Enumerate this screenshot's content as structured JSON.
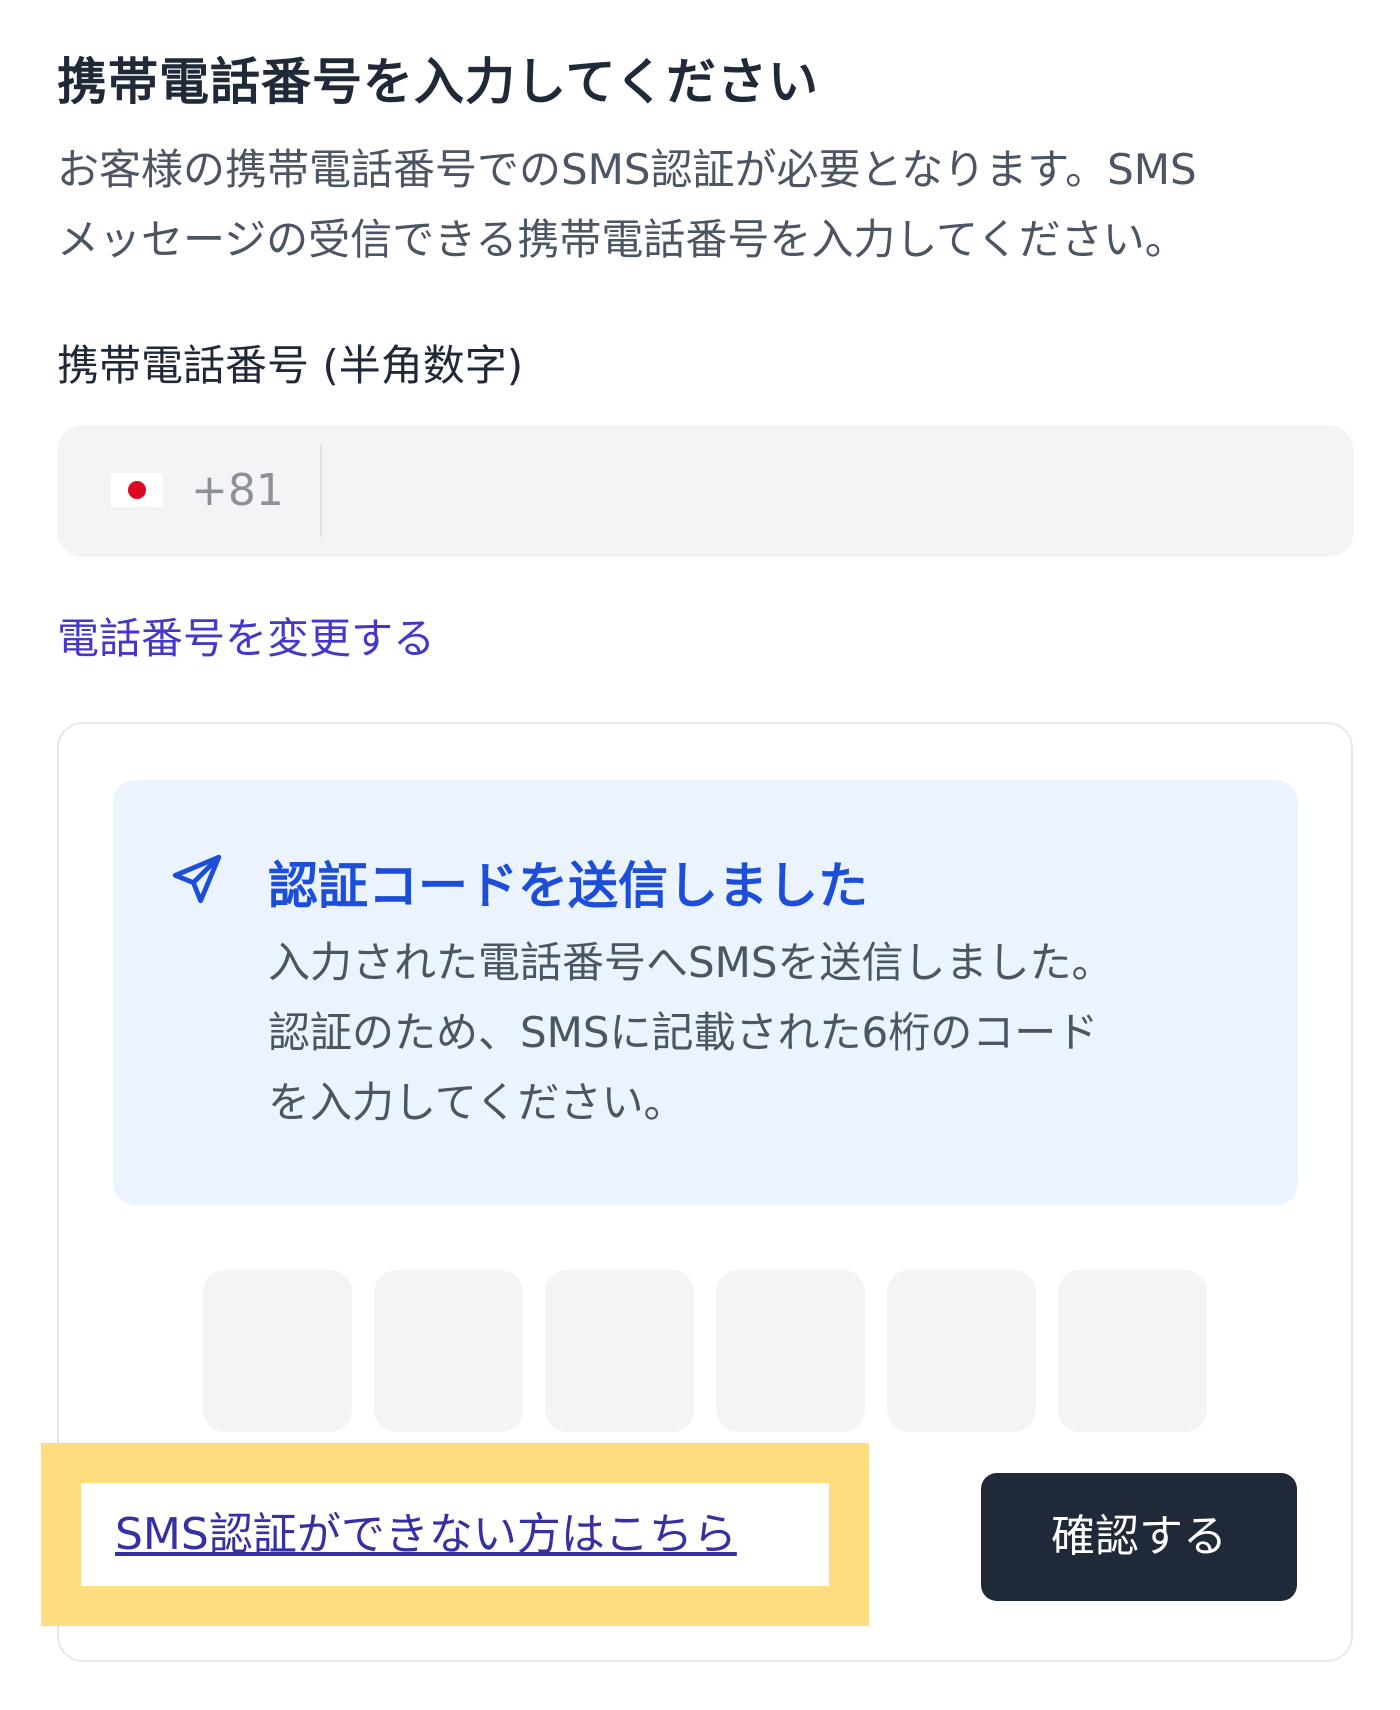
{
  "header": {
    "title": "携帯電話番号を入力してください",
    "description_line1": "お客様の携帯電話番号でのSMS認証が必要となります。SMS",
    "description_line2": "メッセージの受信できる携帯電話番号を入力してください。"
  },
  "phone": {
    "label": "携帯電話番号 (半角数字)",
    "country_flag": "japan-flag",
    "country_code": "+81",
    "value": "",
    "change_link": "電話番号を変更する"
  },
  "notice": {
    "icon": "send-icon",
    "title": "認証コードを送信しました",
    "body_line1": "入力された電話番号へSMSを送信しました。",
    "body_line2": "認証のため、SMSに記載された6桁のコード",
    "body_line3": "を入力してください。"
  },
  "code_inputs": [
    "",
    "",
    "",
    "",
    "",
    ""
  ],
  "actions": {
    "sms_help_link": "SMS認証ができない方はこちら",
    "confirm_button": "確認する"
  },
  "colors": {
    "link": "#4338ca",
    "notice_title": "#1d4ed8",
    "notice_bg": "#eaf3fe",
    "highlight": "#fedd7e",
    "button_bg": "#1f2937"
  }
}
